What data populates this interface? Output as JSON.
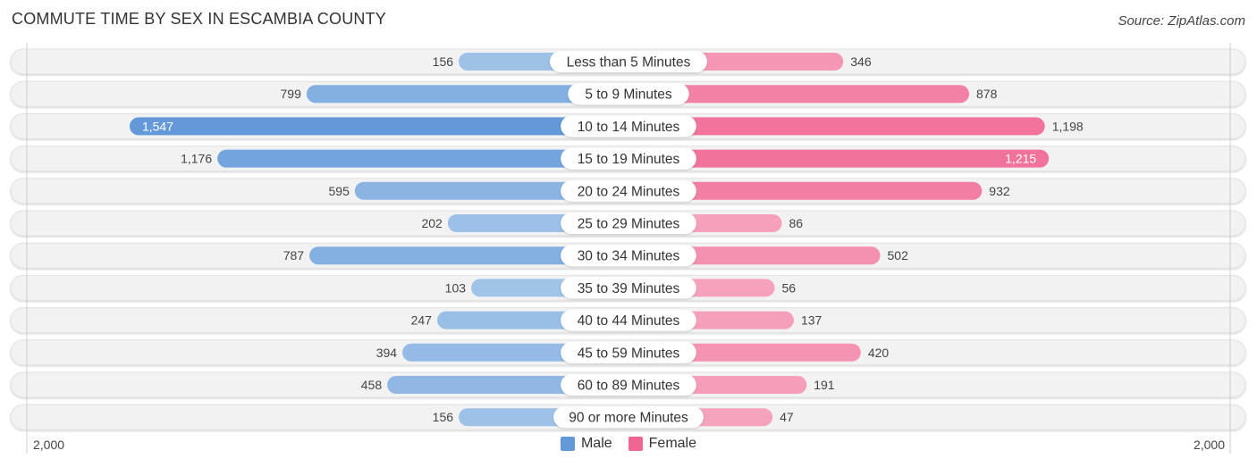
{
  "header": {
    "title": "COMMUTE TIME BY SEX IN ESCAMBIA COUNTY",
    "source": "Source: ZipAtlas.com"
  },
  "legend": {
    "male_label": "Male",
    "female_label": "Female"
  },
  "axis": {
    "left_label": "2,000",
    "right_label": "2,000"
  },
  "colors": {
    "male_strong": "#6399d9",
    "male_light": "#a8c8ea",
    "female_strong": "#f06591",
    "female_light": "#f7a8c1",
    "row_bg": "#f2f2f2"
  },
  "chart_data": {
    "type": "bar",
    "orientation": "horizontal-diverging",
    "title": "COMMUTE TIME BY SEX IN ESCAMBIA COUNTY",
    "categories": [
      "Less than 5 Minutes",
      "5 to 9 Minutes",
      "10 to 14 Minutes",
      "15 to 19 Minutes",
      "20 to 24 Minutes",
      "25 to 29 Minutes",
      "30 to 34 Minutes",
      "35 to 39 Minutes",
      "40 to 44 Minutes",
      "45 to 59 Minutes",
      "60 to 89 Minutes",
      "90 or more Minutes"
    ],
    "series": [
      {
        "name": "Male",
        "values": [
          156,
          799,
          1547,
          1176,
          595,
          202,
          787,
          103,
          247,
          394,
          458,
          156
        ],
        "labels": [
          "156",
          "799",
          "1,547",
          "1,176",
          "595",
          "202",
          "787",
          "103",
          "247",
          "394",
          "458",
          "156"
        ]
      },
      {
        "name": "Female",
        "values": [
          346,
          878,
          1198,
          1215,
          932,
          86,
          502,
          56,
          137,
          420,
          191,
          47
        ],
        "labels": [
          "346",
          "878",
          "1,198",
          "1,215",
          "932",
          "86",
          "502",
          "56",
          "137",
          "420",
          "191",
          "47"
        ]
      }
    ],
    "xlim": [
      -2000,
      2000
    ],
    "tick_labels": [
      "2,000",
      "2,000"
    ],
    "legend_position": "bottom-center",
    "grid": false
  }
}
